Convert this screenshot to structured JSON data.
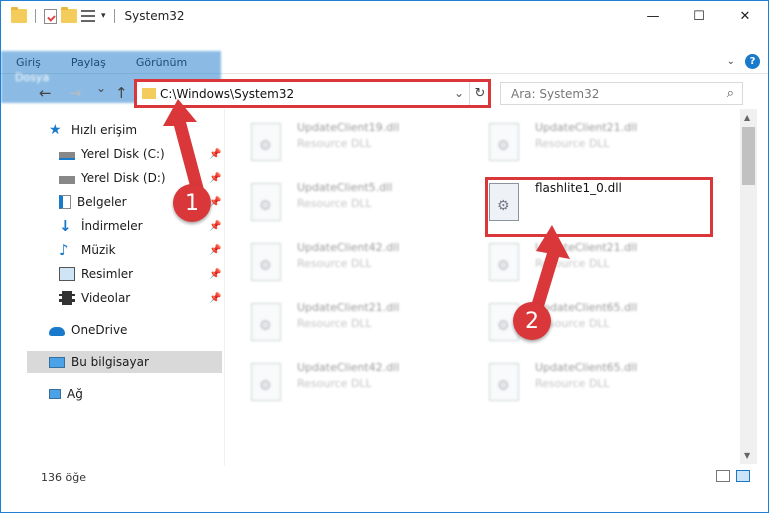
{
  "window": {
    "title": "System32",
    "controls": {
      "minimize": "—",
      "maximize": "☐",
      "close": "✕"
    }
  },
  "ribbon": {
    "tabs": [
      "Dosya",
      "Giriş",
      "Paylaş",
      "Görünüm"
    ],
    "help": "?"
  },
  "nav": {
    "back": "←",
    "forward": "→",
    "recent": "⌄",
    "up": "↑"
  },
  "address": {
    "path": "C:\\Windows\\System32",
    "dropdown": "⌄",
    "refresh": "↻"
  },
  "search": {
    "placeholder": "Ara: System32",
    "icon": "search-icon"
  },
  "sidebar": {
    "items": [
      {
        "label": "Hızlı erişim",
        "icon": "star-icon"
      },
      {
        "label": "Yerel Disk (C:)",
        "icon": "drive-icon",
        "pinned": true
      },
      {
        "label": "Yerel Disk (D:)",
        "icon": "drive-icon",
        "pinned": true
      },
      {
        "label": "Belgeler",
        "icon": "documents-icon",
        "pinned": true
      },
      {
        "label": "İndirmeler",
        "icon": "downloads-icon",
        "pinned": true
      },
      {
        "label": "Müzik",
        "icon": "music-icon",
        "pinned": true
      },
      {
        "label": "Resimler",
        "icon": "pictures-icon",
        "pinned": true
      },
      {
        "label": "Videolar",
        "icon": "videos-icon",
        "pinned": true
      },
      {
        "label": "OneDrive",
        "icon": "cloud-icon"
      },
      {
        "label": "Bu bilgisayar",
        "icon": "computer-icon"
      },
      {
        "label": "Ağ",
        "icon": "network-icon"
      }
    ],
    "selected": "Bu bilgisayar"
  },
  "files": [
    {
      "name": "UpdateClient19.dll",
      "type": "Resource DLL"
    },
    {
      "name": "UpdateClient21.dll",
      "type": "Resource DLL"
    },
    {
      "name": "UpdateClient5.dll",
      "type": "Resource DLL"
    },
    {
      "name": "flashlite1_0.dll",
      "type": ""
    },
    {
      "name": "UpdateClient42.dll",
      "type": "Resource DLL"
    },
    {
      "name": "UpdateClient21.dll",
      "type": "Resource DLL"
    },
    {
      "name": "UpdateClient21.dll",
      "type": "Resource DLL"
    },
    {
      "name": "UpdateClient65.dll",
      "type": "Resource DLL"
    },
    {
      "name": "UpdateClient42.dll",
      "type": "Resource DLL"
    },
    {
      "name": "UpdateClient65.dll",
      "type": "Resource DLL"
    }
  ],
  "status": {
    "count": "136 öğe"
  },
  "annotations": {
    "step1": "1",
    "step2": "2",
    "color": "#d9373a"
  }
}
